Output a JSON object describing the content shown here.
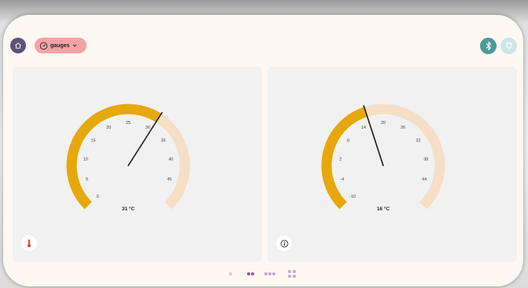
{
  "header": {
    "home_icon": "home-icon",
    "dropdown_icon": "gauge-icon",
    "dropdown_label": "gauges",
    "bluetooth_icon": "bluetooth-icon",
    "usb_icon": "usb-plug-icon"
  },
  "colors": {
    "accent_fill": "#e6a80c",
    "track": "#f5dfc6",
    "needle": "#1a1a1a",
    "home_btn": "#5b5478",
    "dropdown_bg": "#f3a3a8",
    "bluetooth_bg": "#4e9a9c",
    "usb_bg": "#cfe5e5",
    "page_dot_active": "#9b4fa6"
  },
  "gauges": [
    {
      "id": "gauge-left",
      "icon": "thermometer-icon",
      "value_label": "31 °C",
      "min": 0,
      "max": 50,
      "value": 31,
      "ticks": [
        "0",
        "5",
        "10",
        "15",
        "20",
        "25",
        "30",
        "35",
        "40",
        "45"
      ]
    },
    {
      "id": "gauge-right",
      "icon": "info-icon",
      "value_label": "16 °C",
      "min": -10,
      "max": 50,
      "value": 16,
      "ticks": [
        "-10",
        "-4",
        "2",
        "8",
        "14",
        "20",
        "26",
        "32",
        "38",
        "44"
      ]
    }
  ],
  "pager": {
    "pages": 4,
    "active_page": 1
  }
}
